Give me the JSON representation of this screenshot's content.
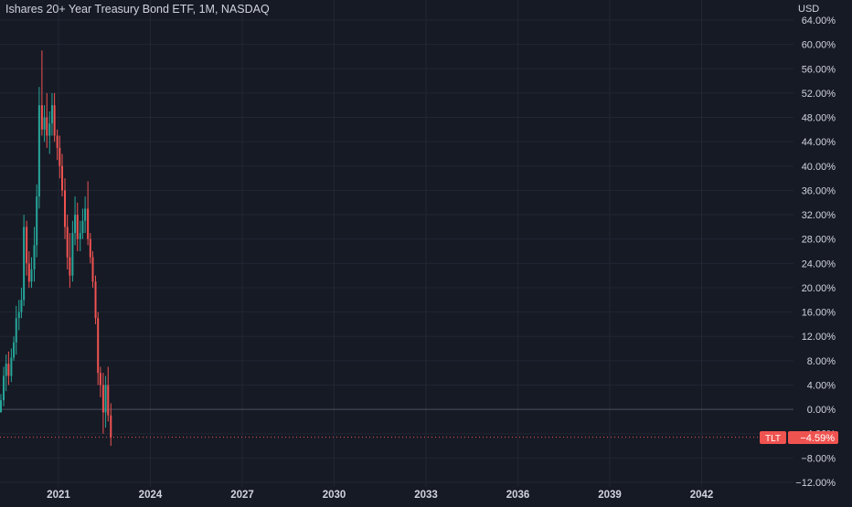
{
  "header": {
    "title": "Ishares 20+ Year Treasury Bond ETF, 1M, NASDAQ",
    "currency": "USD"
  },
  "price_tag": {
    "symbol": "TLT",
    "value": "−4.59%"
  },
  "colors": {
    "background": "#161a25",
    "grid": "#222634",
    "text": "#d1d4dc",
    "up": "#26a69a",
    "down": "#ef5350",
    "zero_line": "#4a4f5c",
    "price_line": "#ef5350"
  },
  "chart_data": {
    "type": "candlestick",
    "title": "Ishares 20+ Year Treasury Bond ETF, 1M, NASDAQ",
    "y_unit": "%",
    "y_scale": "percent",
    "y_ticks": [
      "64.00%",
      "60.00%",
      "56.00%",
      "52.00%",
      "48.00%",
      "44.00%",
      "40.00%",
      "36.00%",
      "32.00%",
      "28.00%",
      "24.00%",
      "20.00%",
      "16.00%",
      "12.00%",
      "8.00%",
      "4.00%",
      "0.00%",
      "−4.00%",
      "−8.00%",
      "−12.00%"
    ],
    "y_values": [
      64,
      60,
      56,
      52,
      48,
      44,
      40,
      36,
      32,
      28,
      24,
      20,
      16,
      12,
      8,
      4,
      0,
      -4,
      -8,
      -12
    ],
    "ylim": [
      -12,
      64
    ],
    "x_ticks": [
      "2021",
      "2024",
      "2027",
      "2030",
      "2033",
      "2036",
      "2039",
      "2042"
    ],
    "x_tick_years": [
      2021,
      2024,
      2027,
      2030,
      2033,
      2036,
      2039,
      2042
    ],
    "xlim": [
      2019.12,
      2045.0
    ],
    "grid": true,
    "zero_line": 0,
    "last_value": -4.59,
    "candles": [
      {
        "t": 2019.12,
        "o": -0.5,
        "h": 2.5,
        "l": -0.5,
        "c": 1.5
      },
      {
        "t": 2019.21,
        "o": 1.5,
        "h": 7.0,
        "l": 0.5,
        "c": 5.5
      },
      {
        "t": 2019.29,
        "o": 5.5,
        "h": 9.0,
        "l": 3.0,
        "c": 7.5
      },
      {
        "t": 2019.37,
        "o": 7.5,
        "h": 9.5,
        "l": 4.0,
        "c": 5.5
      },
      {
        "t": 2019.46,
        "o": 5.5,
        "h": 10.0,
        "l": 4.5,
        "c": 8.5
      },
      {
        "t": 2019.54,
        "o": 8.5,
        "h": 12.0,
        "l": 8.0,
        "c": 11.0
      },
      {
        "t": 2019.62,
        "o": 11.0,
        "h": 17.0,
        "l": 9.0,
        "c": 15.0
      },
      {
        "t": 2019.71,
        "o": 15.0,
        "h": 18.0,
        "l": 13.0,
        "c": 16.0
      },
      {
        "t": 2019.79,
        "o": 16.0,
        "h": 20.0,
        "l": 15.0,
        "c": 18.0
      },
      {
        "t": 2019.87,
        "o": 18.0,
        "h": 32.0,
        "l": 17.0,
        "c": 30.0
      },
      {
        "t": 2019.96,
        "o": 30.0,
        "h": 31.0,
        "l": 22.0,
        "c": 24.0
      },
      {
        "t": 2020.04,
        "o": 24.0,
        "h": 26.0,
        "l": 20.0,
        "c": 21.0
      },
      {
        "t": 2020.12,
        "o": 21.0,
        "h": 25.0,
        "l": 20.0,
        "c": 23.0
      },
      {
        "t": 2020.21,
        "o": 23.0,
        "h": 30.0,
        "l": 21.0,
        "c": 27.0
      },
      {
        "t": 2020.29,
        "o": 27.0,
        "h": 37.0,
        "l": 25.0,
        "c": 35.0
      },
      {
        "t": 2020.37,
        "o": 35.0,
        "h": 53.0,
        "l": 33.0,
        "c": 50.0
      },
      {
        "t": 2020.46,
        "o": 50.0,
        "h": 59.0,
        "l": 45.0,
        "c": 46.0
      },
      {
        "t": 2020.54,
        "o": 46.0,
        "h": 50.0,
        "l": 44.0,
        "c": 48.0
      },
      {
        "t": 2020.62,
        "o": 48.0,
        "h": 52.0,
        "l": 43.0,
        "c": 45.0
      },
      {
        "t": 2020.71,
        "o": 45.0,
        "h": 49.0,
        "l": 42.0,
        "c": 47.0
      },
      {
        "t": 2020.79,
        "o": 47.0,
        "h": 52.0,
        "l": 45.0,
        "c": 50.0
      },
      {
        "t": 2020.87,
        "o": 50.0,
        "h": 52.0,
        "l": 44.0,
        "c": 45.0
      },
      {
        "t": 2020.96,
        "o": 45.0,
        "h": 46.0,
        "l": 41.0,
        "c": 43.0
      },
      {
        "t": 2021.04,
        "o": 43.0,
        "h": 45.0,
        "l": 38.0,
        "c": 40.0
      },
      {
        "t": 2021.12,
        "o": 40.0,
        "h": 42.0,
        "l": 35.0,
        "c": 36.0
      },
      {
        "t": 2021.21,
        "o": 36.0,
        "h": 38.0,
        "l": 28.0,
        "c": 30.0
      },
      {
        "t": 2021.29,
        "o": 30.0,
        "h": 32.0,
        "l": 23.0,
        "c": 25.0
      },
      {
        "t": 2021.37,
        "o": 25.0,
        "h": 29.0,
        "l": 20.0,
        "c": 22.0
      },
      {
        "t": 2021.46,
        "o": 22.0,
        "h": 31.0,
        "l": 21.0,
        "c": 29.0
      },
      {
        "t": 2021.54,
        "o": 29.0,
        "h": 35.0,
        "l": 27.0,
        "c": 32.0
      },
      {
        "t": 2021.62,
        "o": 32.0,
        "h": 34.0,
        "l": 26.0,
        "c": 28.0
      },
      {
        "t": 2021.71,
        "o": 28.0,
        "h": 31.0,
        "l": 26.0,
        "c": 29.0
      },
      {
        "t": 2021.79,
        "o": 29.0,
        "h": 33.0,
        "l": 28.0,
        "c": 31.0
      },
      {
        "t": 2021.87,
        "o": 31.0,
        "h": 35.0,
        "l": 29.0,
        "c": 33.0
      },
      {
        "t": 2021.96,
        "o": 33.0,
        "h": 37.5,
        "l": 27.0,
        "c": 28.0
      },
      {
        "t": 2022.04,
        "o": 28.0,
        "h": 29.0,
        "l": 24.0,
        "c": 25.0
      },
      {
        "t": 2022.12,
        "o": 25.0,
        "h": 26.0,
        "l": 20.0,
        "c": 21.0
      },
      {
        "t": 2022.21,
        "o": 21.0,
        "h": 22.0,
        "l": 14.0,
        "c": 15.0
      },
      {
        "t": 2022.29,
        "o": 15.0,
        "h": 16.0,
        "l": 4.0,
        "c": 6.0
      },
      {
        "t": 2022.37,
        "o": 6.0,
        "h": 7.0,
        "l": 2.0,
        "c": 4.0
      },
      {
        "t": 2022.46,
        "o": 4.0,
        "h": 6.0,
        "l": -4.0,
        "c": -0.5
      },
      {
        "t": 2022.54,
        "o": -0.5,
        "h": 5.5,
        "l": -3.0,
        "c": 4.0
      },
      {
        "t": 2022.62,
        "o": 4.0,
        "h": 7.0,
        "l": -2.0,
        "c": -1.0
      },
      {
        "t": 2022.71,
        "o": -1.0,
        "h": 1.0,
        "l": -6.0,
        "c": -4.59
      }
    ]
  }
}
